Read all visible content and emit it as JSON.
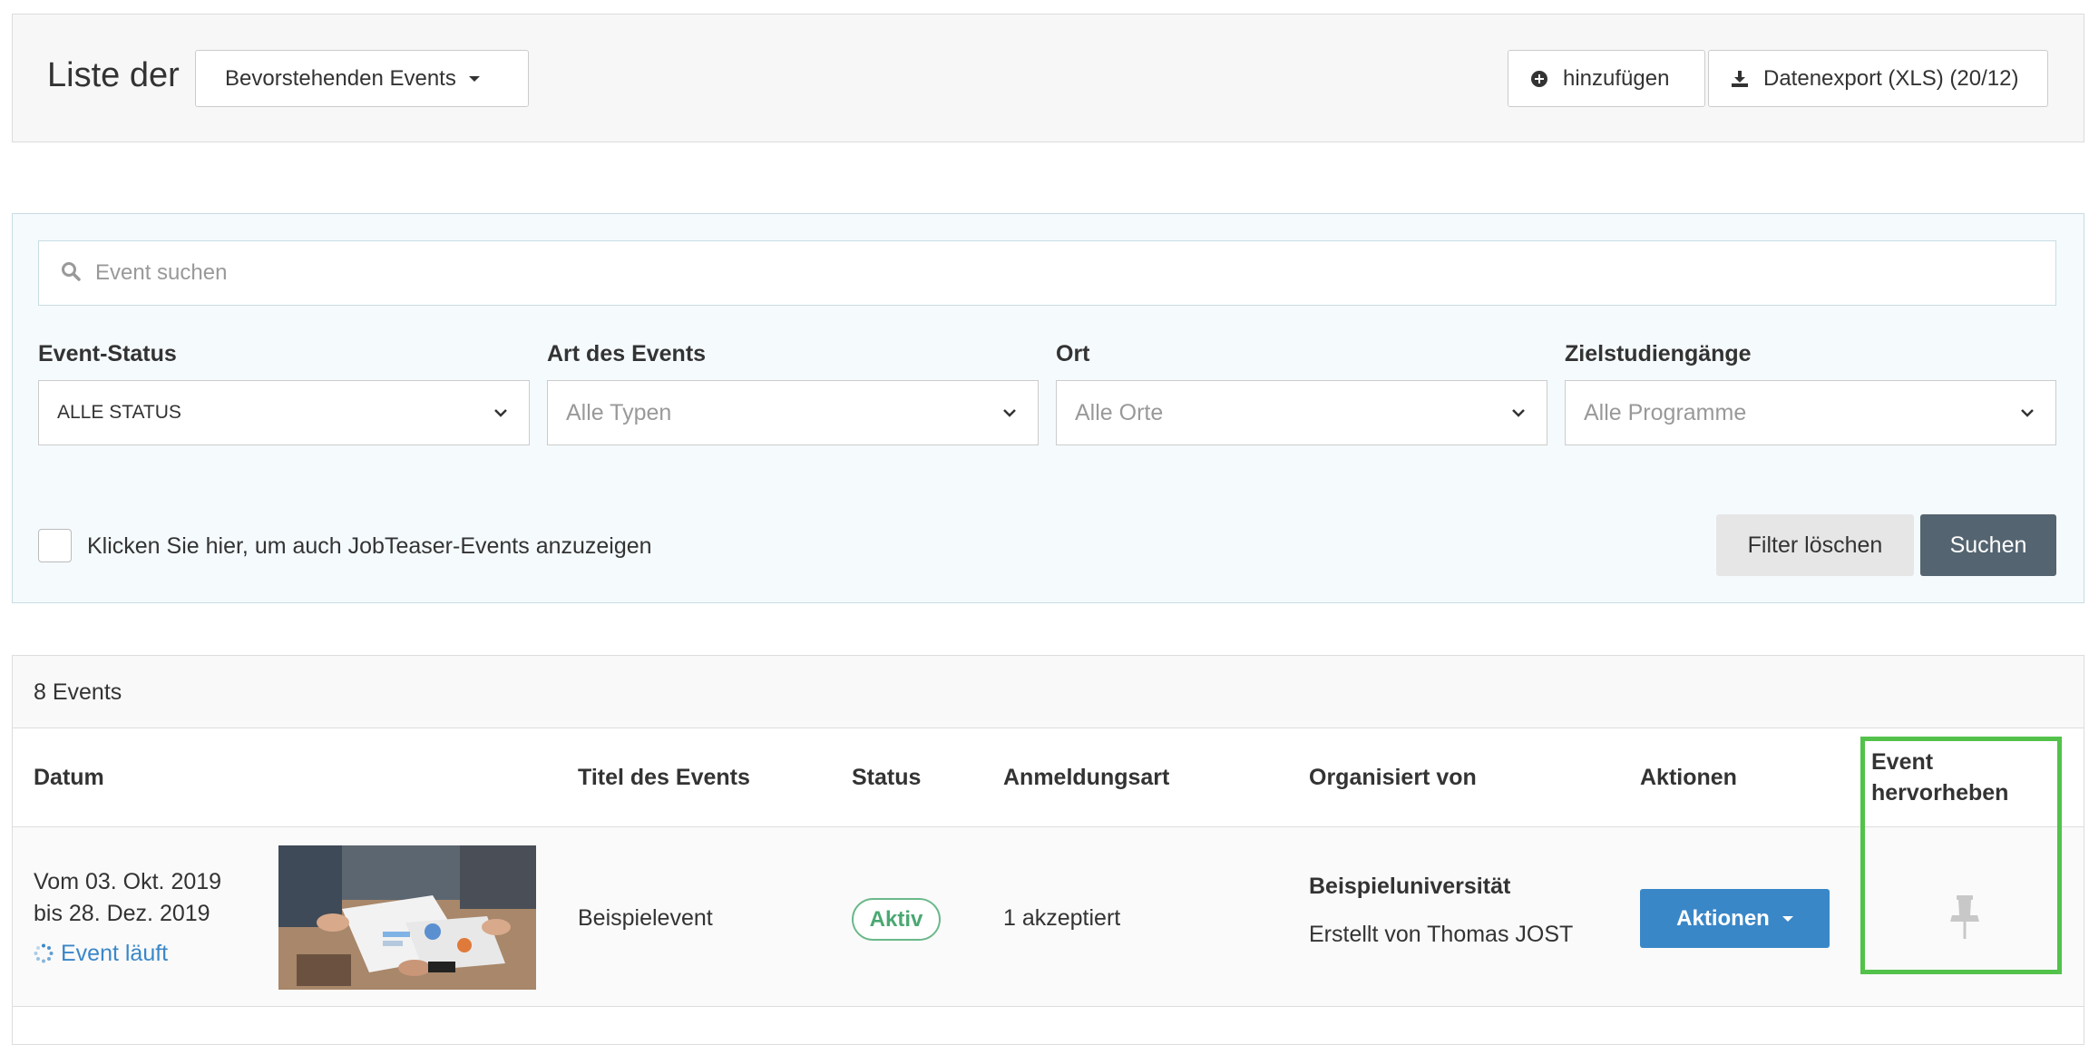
{
  "header": {
    "title": "Liste der",
    "period_select": "Bevorstehenden Events",
    "add_button": "hinzufügen",
    "export_button": "Datenexport (XLS) (20/12)"
  },
  "filters": {
    "search_placeholder": "Event suchen",
    "status": {
      "label": "Event-Status",
      "value": "ALLE STATUS"
    },
    "type": {
      "label": "Art des Events",
      "placeholder": "Alle Typen"
    },
    "location": {
      "label": "Ort",
      "placeholder": "Alle Orte"
    },
    "programs": {
      "label": "Zielstudiengänge",
      "placeholder": "Alle Programme"
    },
    "checkbox_label": "Klicken Sie hier, um auch JobTeaser-Events anzuzeigen",
    "reset_button": "Filter löschen",
    "search_button": "Suchen"
  },
  "table": {
    "count": "8 Events",
    "columns": {
      "date": "Datum",
      "title": "Titel des Events",
      "status": "Status",
      "registration": "Anmeldungsart",
      "organizer": "Organisiert von",
      "actions": "Aktionen",
      "highlight_line1": "Event",
      "highlight_line2": "hervorheben"
    },
    "rows": [
      {
        "date_from": "Vom 03. Okt. 2019",
        "date_to": "bis 28. Dez. 2019",
        "running": "Event läuft",
        "title": "Beispielevent",
        "status": "Aktiv",
        "registration": "1 akzeptiert",
        "organizer": "Beispieluniversität",
        "created_by": "Erstellt von Thomas JOST",
        "actions_button": "Aktionen"
      }
    ]
  },
  "colors": {
    "primary": "#3a87c8",
    "dark_button": "#546470",
    "success": "#4aa872",
    "highlight_border": "#52c24a"
  },
  "icons": [
    "plus-circle-icon",
    "download-icon",
    "search-icon",
    "chevron-down-icon",
    "spinner-icon",
    "pin-icon"
  ]
}
